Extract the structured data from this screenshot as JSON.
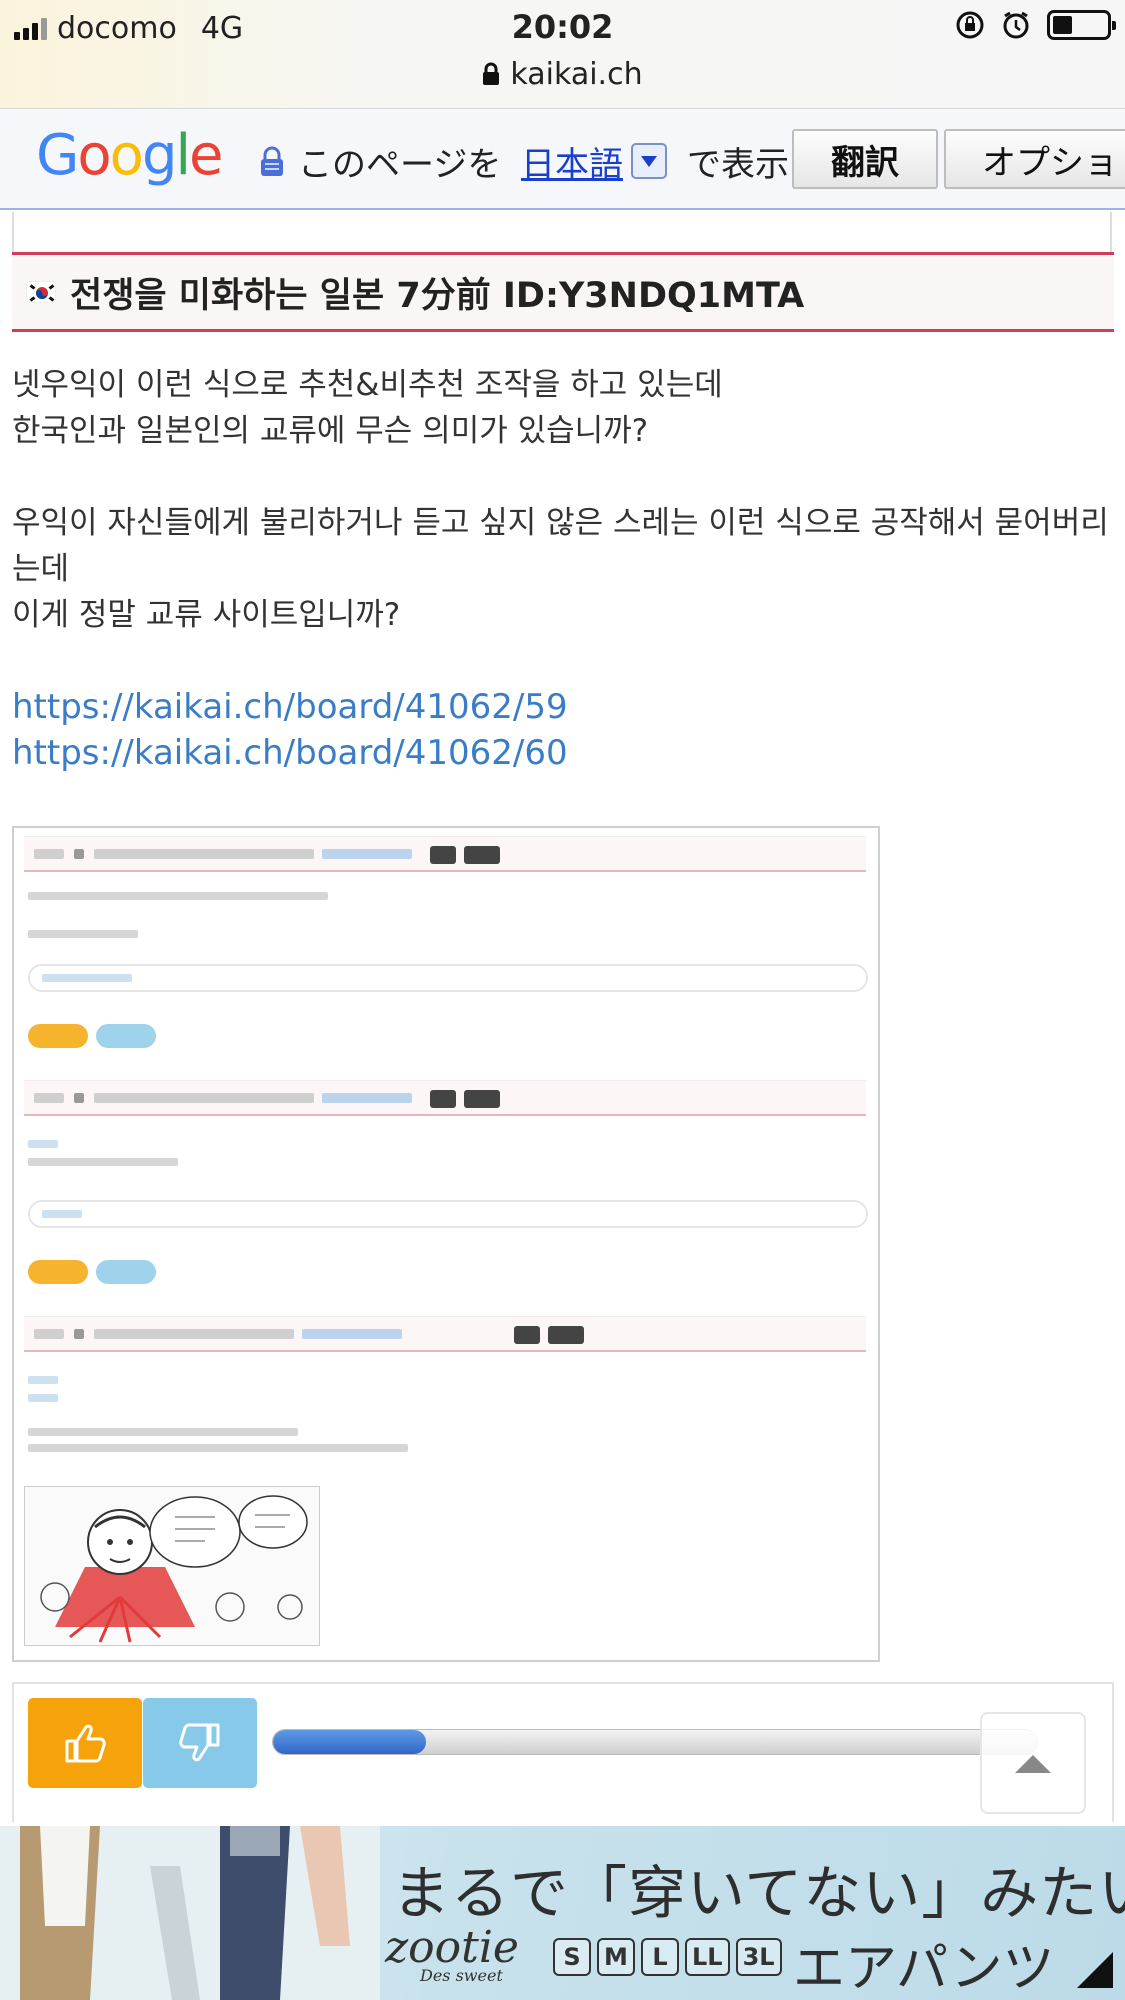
{
  "status_bar": {
    "carrier": "docomo",
    "network": "4G",
    "time": "20:02",
    "url": "kaikai.ch",
    "battery_level": 0.4
  },
  "translate_bar": {
    "logo": "Google",
    "text_before": "このページを",
    "language": "日本語",
    "text_after": "で表示",
    "translate_button": "翻訳",
    "options_button": "オプショ"
  },
  "post": {
    "header": "전쟁을 미화하는 일본  7分前  ID:Y3NDQ1MTA",
    "flag_icon": "korea-flag-icon",
    "body_lines": [
      "넷우익이 이런 식으로 추천&비추천 조작을 하고 있는데",
      "한국인과 일본인의 교류에 무슨 의미가 있습니까?",
      "",
      "우익이 자신들에게 불리하거나 듣고 싶지 않은 스레는 이런 식으로 공작해서 묻어버리",
      "는데",
      "이게 정말 교류 사이트입니까?"
    ],
    "links": [
      "https://kaikai.ch/board/41062/59",
      "https://kaikai.ch/board/41062/60"
    ]
  },
  "vote": {
    "up_icon": "thumbs-up-icon",
    "down_icon": "thumbs-down-icon",
    "ratio": 0.2
  },
  "ad": {
    "headline": "まるで「穿いてない」みたい",
    "brand": "zootie",
    "brand_sub": "Des sweet",
    "sizes": [
      "S",
      "M",
      "L",
      "LL",
      "3L"
    ],
    "product": "エアパンツ"
  },
  "colors": {
    "accent_red": "#d43a5a",
    "link_blue": "#3a7cc7",
    "vote_up": "#f6a20a",
    "vote_down": "#86c9e9"
  }
}
